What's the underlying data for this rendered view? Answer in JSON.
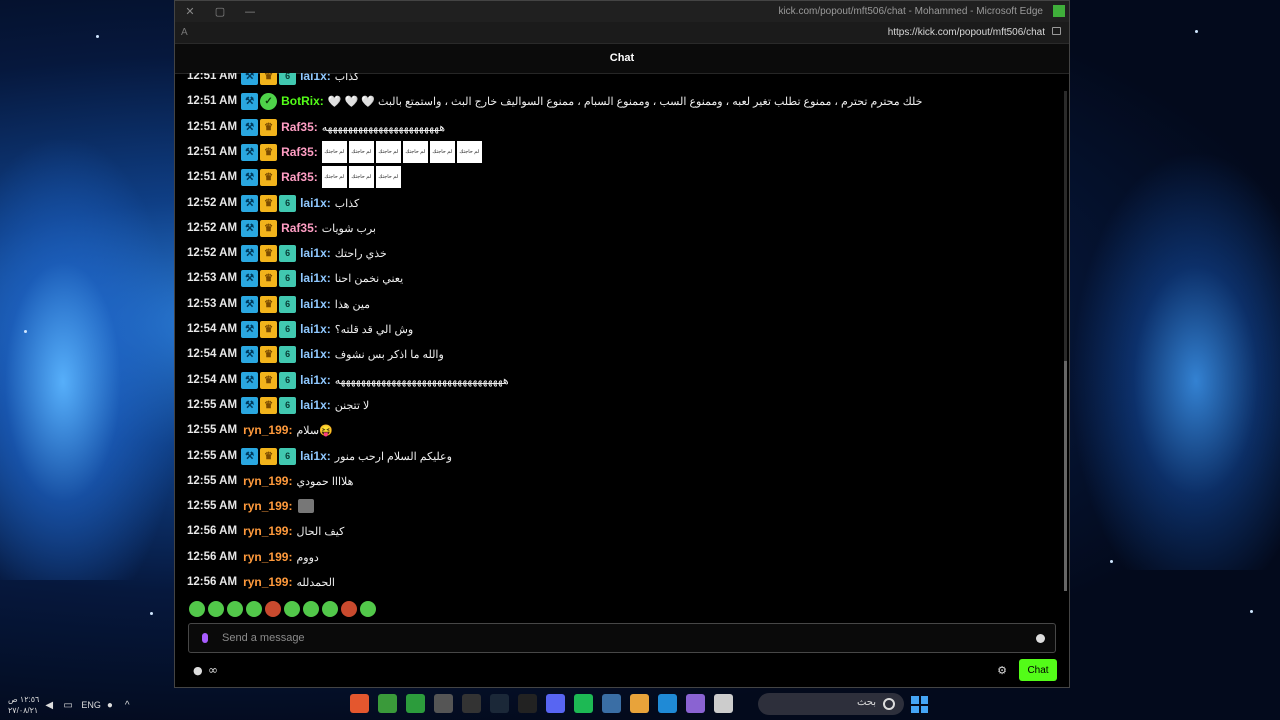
{
  "window": {
    "title": "kick.com/popout/mft506/chat - Mohammed - Microsoft Edge",
    "url": "https://kick.com/popout/mft506/chat",
    "aa_icon": "A",
    "min_icon": "—",
    "max_icon": "▢",
    "close_icon": "✕"
  },
  "chat": {
    "header": "Chat",
    "messages": [
      {
        "time": "12:51 AM",
        "user": "lai1x:",
        "text": "كذاب"
      },
      {
        "time": "12:51 AM",
        "user": "BotRix:",
        "text": "🤍 🤍 🤍 خلك محترم تحترم ، ممنوع تطلب تغير لعبه ، وممنوع السب ، وممنوع السبام ، ممنوع السواليف خارج البث ، واستمتع بالبث"
      },
      {
        "time": "12:51 AM",
        "user": "Raf35:",
        "text": "هههههههههههههههههههههههه"
      },
      {
        "time": "12:51 AM",
        "user": "Raf35:",
        "text": ""
      },
      {
        "time": "12:51 AM",
        "user": "Raf35:",
        "text": ""
      },
      {
        "time": "12:52 AM",
        "user": "lai1x:",
        "text": "كذاب"
      },
      {
        "time": "12:52 AM",
        "user": "Raf35:",
        "text": "برب شويات"
      },
      {
        "time": "12:52 AM",
        "user": "lai1x:",
        "text": "خذي راحتك"
      },
      {
        "time": "12:53 AM",
        "user": "lai1x:",
        "text": "يعني نخمن احنا"
      },
      {
        "time": "12:53 AM",
        "user": "lai1x:",
        "text": "مين هذا"
      },
      {
        "time": "12:54 AM",
        "user": "lai1x:",
        "text": "وش الي قد قلته؟"
      },
      {
        "time": "12:54 AM",
        "user": "lai1x:",
        "text": "والله ما اذكر بس نشوف"
      },
      {
        "time": "12:54 AM",
        "user": "lai1x:",
        "text": "هههههههههههههههههههههههههههههههههه"
      },
      {
        "time": "12:55 AM",
        "user": "lai1x:",
        "text": "لا تتجنن"
      },
      {
        "time": "12:55 AM",
        "user": "ryn_199:",
        "text": "سلام😝"
      },
      {
        "time": "12:55 AM",
        "user": "lai1x:",
        "text": "وعليكم السلام ارحب منور"
      },
      {
        "time": "12:55 AM",
        "user": "ryn_199:",
        "text": "هلاااا حمودي"
      },
      {
        "time": "12:55 AM",
        "user": "ryn_199:",
        "text": ""
      },
      {
        "time": "12:56 AM",
        "user": "ryn_199:",
        "text": "كيف الحال"
      },
      {
        "time": "12:56 AM",
        "user": "ryn_199:",
        "text": "دووم"
      },
      {
        "time": "12:56 AM",
        "user": "ryn_199:",
        "text": "الحمدلله"
      }
    ],
    "emote_card_text": "لم حاجتك",
    "input_placeholder": "Send a message",
    "points_value": "∞",
    "send_label": "Chat"
  },
  "taskbar": {
    "clock_time": "١٢:٥٦ ص",
    "clock_date": "٢٧/٠٨/٢١",
    "language": "ENG",
    "search_text": "بحث"
  },
  "colors": {
    "kick_green": "#53fc18",
    "user_lai1x": "#8fc8ff",
    "user_raf35": "#ff9ec4",
    "user_ryn": "#ff9a3c"
  }
}
